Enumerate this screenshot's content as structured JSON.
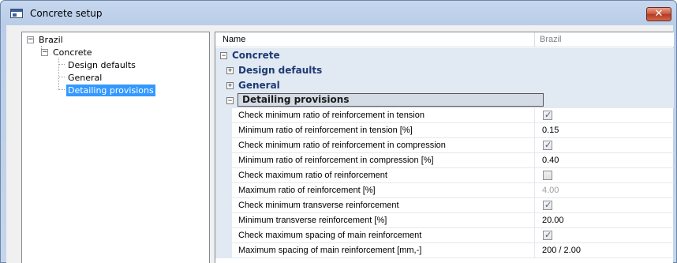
{
  "window": {
    "title": "Concrete setup",
    "close_label": "✕"
  },
  "tree": {
    "root": "Brazil",
    "child": "Concrete",
    "leaves": [
      "Design defaults",
      "General",
      "Detailing provisions"
    ]
  },
  "grid": {
    "header_name": "Name",
    "header_value": "Brazil",
    "categories": {
      "concrete": "Concrete",
      "design_defaults": "Design defaults",
      "general": "General",
      "detailing": "Detailing provisions"
    },
    "rows": [
      {
        "label": "Check minimum ratio of reinforcement in tension",
        "type": "check",
        "checked": true
      },
      {
        "label": "Minimum ratio of reinforcement in tension [%]",
        "type": "text",
        "value": "0.15"
      },
      {
        "label": "Check minimum ratio of reinforcement in compression",
        "type": "check",
        "checked": true
      },
      {
        "label": "Minimum ratio of reinforcement in compression [%]",
        "type": "text",
        "value": "0.40"
      },
      {
        "label": "Check maximum ratio of reinforcement",
        "type": "check",
        "checked": false
      },
      {
        "label": "Maximum ratio of reinforcement [%]",
        "type": "text",
        "value": "4.00",
        "disabled": true
      },
      {
        "label": "Check minimum transverse reinforcement",
        "type": "check",
        "checked": true
      },
      {
        "label": "Minimum transverse reinforcement [%]",
        "type": "text",
        "value": "20.00"
      },
      {
        "label": "Check maximum spacing of main reinforcement",
        "type": "check",
        "checked": true
      },
      {
        "label": "Maximum spacing of main reinforcement [mm,-]",
        "type": "text",
        "value": "200 / 2.00"
      }
    ]
  },
  "icons": {
    "expanded": "⊟",
    "collapsed": "⊞",
    "check": "✓"
  }
}
